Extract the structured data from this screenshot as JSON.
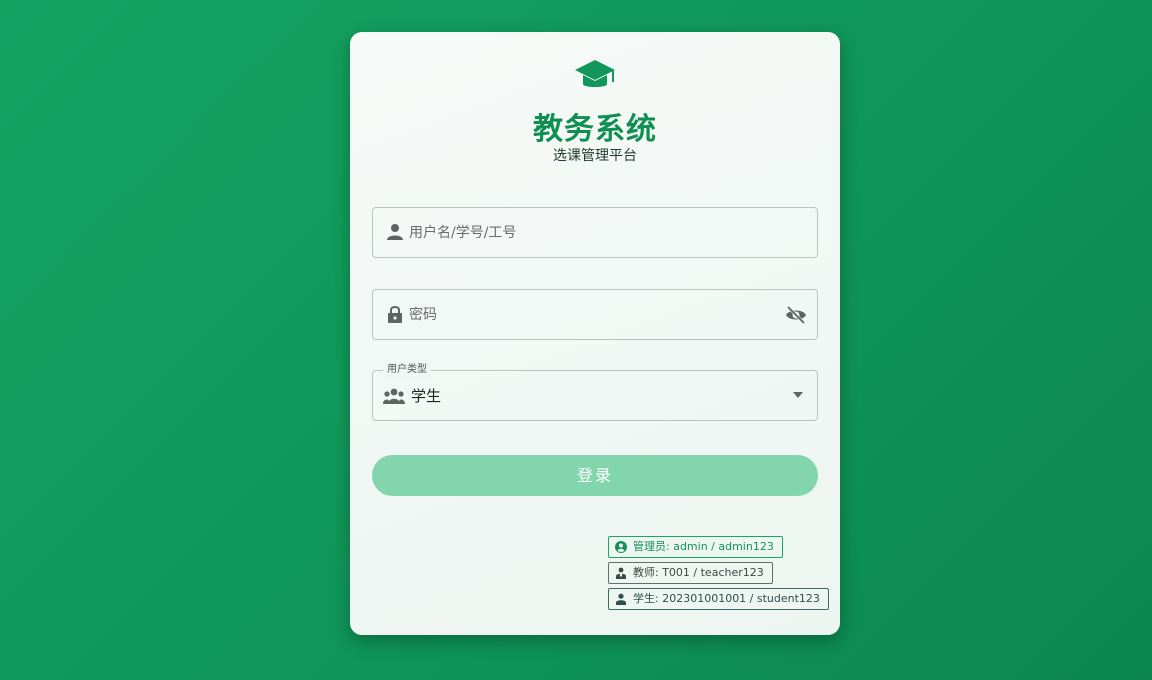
{
  "app": {
    "title": "教务系统",
    "subtitle": "选课管理平台"
  },
  "form": {
    "username": {
      "placeholder": "用户名/学号/工号",
      "value": ""
    },
    "password": {
      "placeholder": "密码",
      "value": ""
    },
    "user_type": {
      "legend": "用户类型",
      "selected": "学生"
    },
    "login_label": "登录"
  },
  "demo_accounts": [
    {
      "label": "管理员: admin / admin123"
    },
    {
      "label": "教师: T001 / teacher123"
    },
    {
      "label": "学生: 202301001001 / student123"
    }
  ],
  "icons": {
    "logo": "graduation-cap-icon",
    "username": "person-icon",
    "password": "lock-icon",
    "toggle_password": "eye-off-icon",
    "user_type": "group-icon",
    "dropdown": "caret-down-icon"
  },
  "colors": {
    "brand": "#0f8f52",
    "background_start": "#15a362",
    "background_end": "#0b874f",
    "button": "#82d5ad",
    "card": "#f3f8f5"
  }
}
